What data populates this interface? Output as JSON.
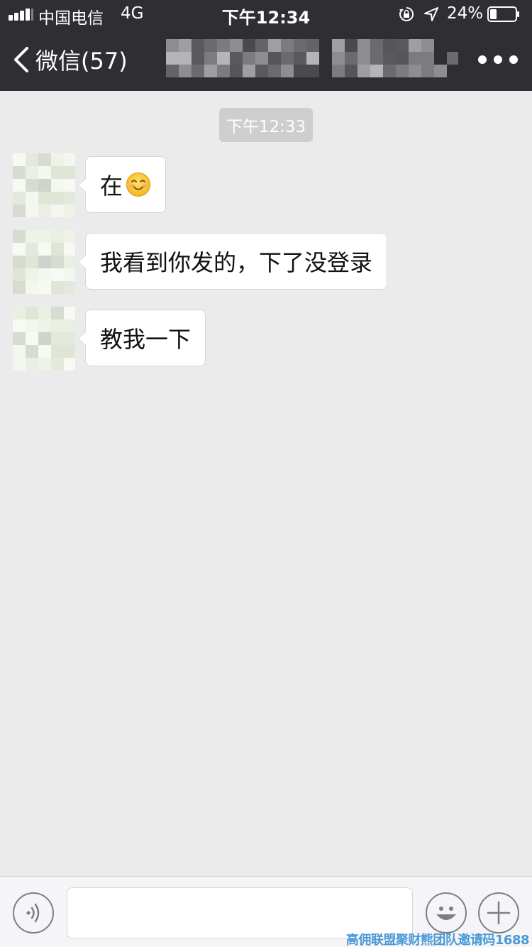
{
  "status_bar": {
    "carrier": "中国电信",
    "network": "4G",
    "time": "下午12:34",
    "battery": "24%"
  },
  "nav": {
    "back_label": "微信(57)",
    "title": ""
  },
  "chat": {
    "time_divider": "下午12:33",
    "messages": [
      {
        "text": "在"
      },
      {
        "text": "我看到你发的，下了没登录"
      },
      {
        "text": "教我一下"
      }
    ]
  },
  "input": {
    "placeholder": ""
  },
  "watermark": "高佣联盟聚财熊团队邀请码1688",
  "colors": {
    "header_bg": "#2f2f33",
    "chat_bg": "#ebebeb",
    "bubble_bg": "#ffffff",
    "time_pill_bg": "#cecece",
    "watermark": "#4a9ad8"
  },
  "icons": [
    "signal-icon",
    "lock-rotation-icon",
    "location-arrow-icon",
    "battery-icon",
    "back-chevron-icon",
    "more-dots-icon",
    "smiley-emoji-icon",
    "voice-icon",
    "emoji-icon",
    "plus-icon"
  ]
}
